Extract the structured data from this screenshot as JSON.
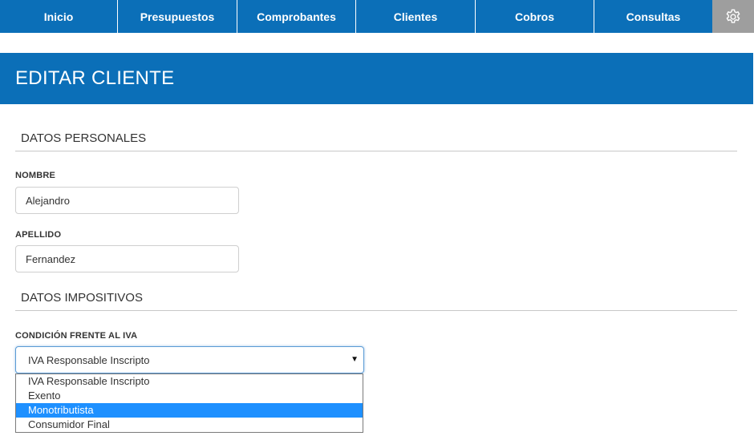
{
  "nav": {
    "items": [
      "Inicio",
      "Presupuestos",
      "Comprobantes",
      "Clientes",
      "Cobros",
      "Consultas"
    ],
    "settings_icon": "gear-icon"
  },
  "page": {
    "title": "EDITAR CLIENTE"
  },
  "personal": {
    "section_title": "DATOS PERSONALES",
    "nombre_label": "NOMBRE",
    "nombre_value": "Alejandro",
    "apellido_label": "APELLIDO",
    "apellido_value": "Fernandez"
  },
  "tax": {
    "section_title": "DATOS IMPOSITIVOS",
    "iva_label": "CONDICIÓN FRENTE AL IVA",
    "iva_selected": "IVA Responsable Inscripto",
    "iva_options": [
      "IVA Responsable Inscripto",
      "Exento",
      "Monotributista",
      "Consumidor Final"
    ],
    "highlighted_option": "Monotributista"
  },
  "colors": {
    "primary": "#0b6fb8",
    "settings_bg": "#9e9e9e",
    "highlight": "#1e90ff"
  }
}
